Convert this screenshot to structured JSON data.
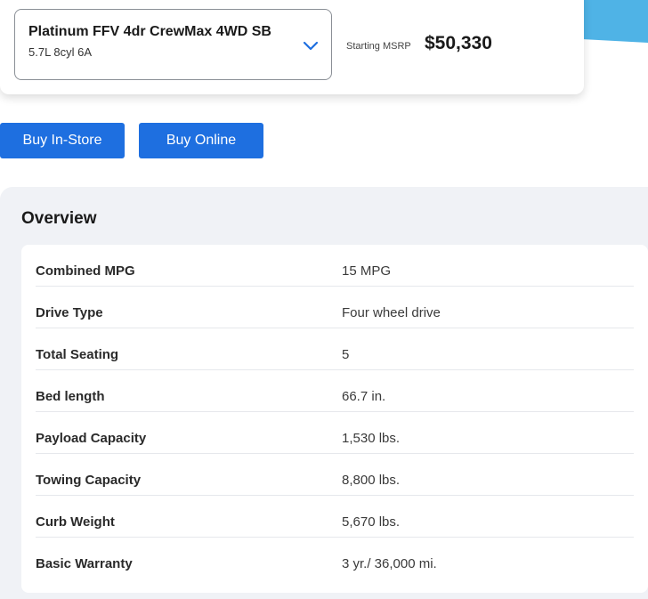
{
  "trim": {
    "name": "Platinum FFV 4dr CrewMax 4WD SB",
    "engine": "5.7L 8cyl 6A",
    "msrp_label": "Starting MSRP",
    "msrp_value": "$50,330"
  },
  "actions": {
    "buy_instore": "Buy In-Store",
    "buy_online": "Buy Online"
  },
  "overview": {
    "title": "Overview",
    "specs": [
      {
        "label": "Combined MPG",
        "value": "15 MPG"
      },
      {
        "label": "Drive Type",
        "value": "Four wheel drive"
      },
      {
        "label": "Total Seating",
        "value": "5"
      },
      {
        "label": "Bed length",
        "value": "66.7 in."
      },
      {
        "label": "Payload Capacity",
        "value": "1,530 lbs."
      },
      {
        "label": "Towing Capacity",
        "value": "8,800 lbs."
      },
      {
        "label": "Curb Weight",
        "value": "5,670 lbs."
      },
      {
        "label": "Basic Warranty",
        "value": "3 yr./ 36,000 mi."
      }
    ]
  },
  "colors": {
    "accent": "#4fb3e6",
    "button": "#1e6fe0",
    "chevron": "#1e6fe0"
  },
  "icons": {
    "dropdown": "chevron-down-icon"
  }
}
